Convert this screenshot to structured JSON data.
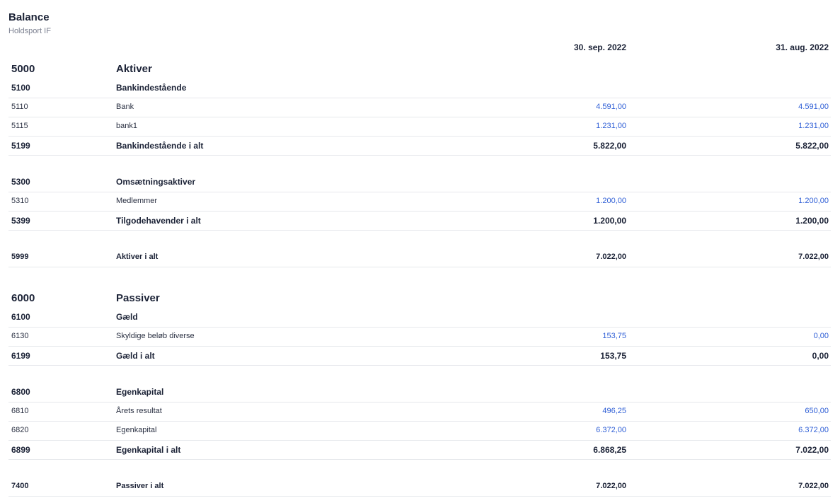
{
  "header": {
    "title": "Balance",
    "subtitle": "Holdsport IF"
  },
  "columns": [
    "30. sep. 2022",
    "31. aug. 2022"
  ],
  "colors": {
    "text": "#1b2236",
    "link_value": "#2f5fd6",
    "divider": "#e6e8ec"
  },
  "aktiver": {
    "code": "5000",
    "name": "Aktiver",
    "bank": {
      "code": "5100",
      "name": "Bankindestående",
      "rows": [
        {
          "code": "5110",
          "name": "Bank",
          "v1": "4.591,00",
          "v2": "4.591,00"
        },
        {
          "code": "5115",
          "name": "bank1",
          "v1": "1.231,00",
          "v2": "1.231,00"
        }
      ],
      "total": {
        "code": "5199",
        "name": "Bankindestående i alt",
        "v1": "5.822,00",
        "v2": "5.822,00"
      }
    },
    "omsaetning": {
      "code": "5300",
      "name": "Omsætningsaktiver",
      "rows": [
        {
          "code": "5310",
          "name": "Medlemmer",
          "v1": "1.200,00",
          "v2": "1.200,00"
        }
      ],
      "total": {
        "code": "5399",
        "name": "Tilgodehavender i alt",
        "v1": "1.200,00",
        "v2": "1.200,00"
      }
    },
    "total": {
      "code": "5999",
      "name": "Aktiver i alt",
      "v1": "7.022,00",
      "v2": "7.022,00"
    }
  },
  "passiver": {
    "code": "6000",
    "name": "Passiver",
    "gaeld": {
      "code": "6100",
      "name": "Gæld",
      "rows": [
        {
          "code": "6130",
          "name": "Skyldige beløb diverse",
          "v1": "153,75",
          "v2": "0,00"
        }
      ],
      "total": {
        "code": "6199",
        "name": "Gæld i alt",
        "v1": "153,75",
        "v2": "0,00"
      }
    },
    "egenkapital": {
      "code": "6800",
      "name": "Egenkapital",
      "rows": [
        {
          "code": "6810",
          "name": "Årets resultat",
          "v1": "496,25",
          "v2": "650,00"
        },
        {
          "code": "6820",
          "name": "Egenkapital",
          "v1": "6.372,00",
          "v2": "6.372,00"
        }
      ],
      "total": {
        "code": "6899",
        "name": "Egenkapital i alt",
        "v1": "6.868,25",
        "v2": "7.022,00"
      }
    },
    "total": {
      "code": "7400",
      "name": "Passiver i alt",
      "v1": "7.022,00",
      "v2": "7.022,00"
    }
  }
}
